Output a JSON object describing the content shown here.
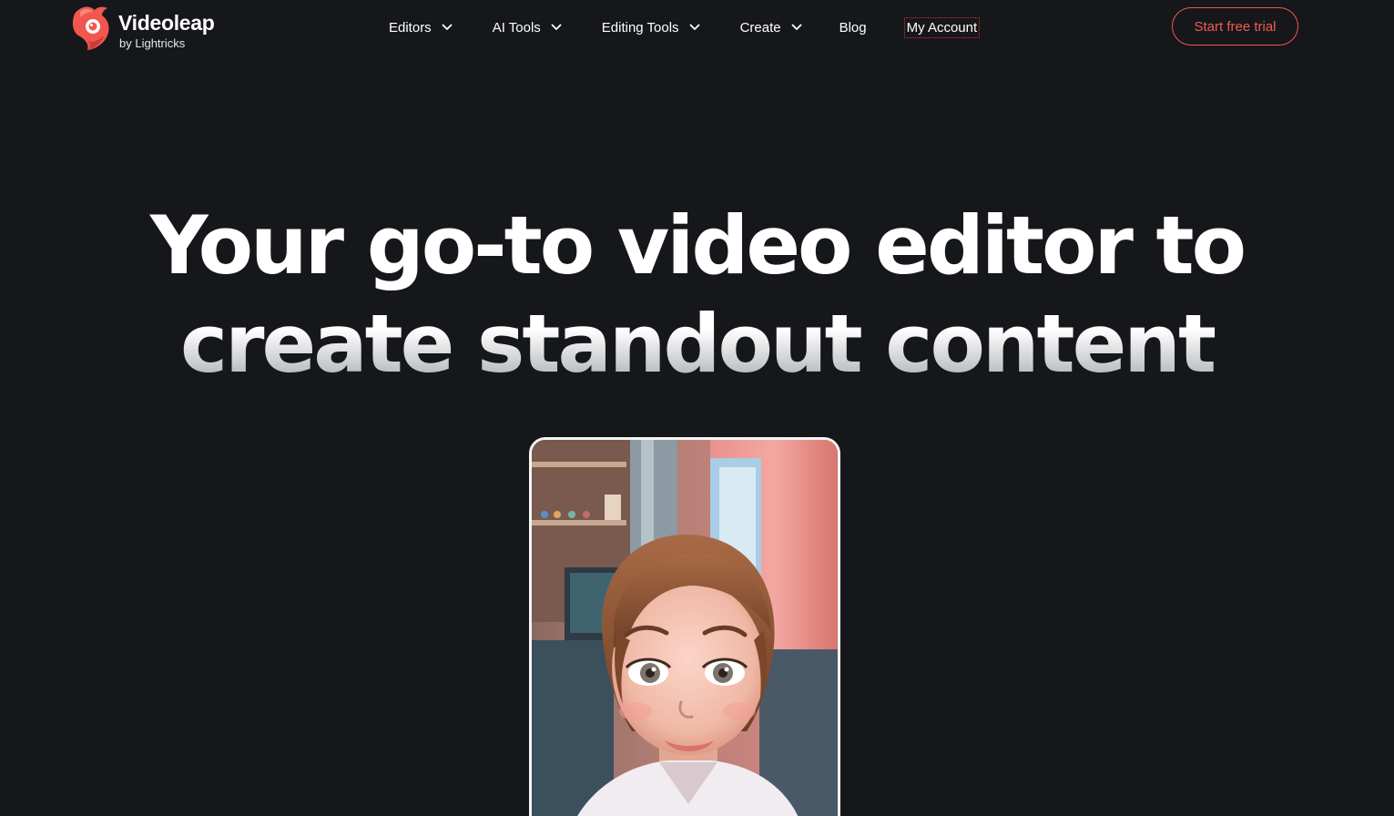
{
  "brand": {
    "name": "Videoleap",
    "tagline": "by Lightricks",
    "accent_color": "#f0574f",
    "logo_icon": "videoleap-bird-icon"
  },
  "nav": {
    "items": [
      {
        "label": "Editors",
        "has_dropdown": true
      },
      {
        "label": "AI Tools",
        "has_dropdown": true
      },
      {
        "label": "Editing Tools",
        "has_dropdown": true
      },
      {
        "label": "Create",
        "has_dropdown": true
      },
      {
        "label": "Blog",
        "has_dropdown": false
      },
      {
        "label": "My Account",
        "has_dropdown": false
      }
    ]
  },
  "cta": {
    "label": "Start free trial"
  },
  "hero": {
    "line1": "Your go-to video editor to",
    "line2": "create standout content"
  },
  "preview": {
    "icon": "animated-portrait-preview"
  }
}
